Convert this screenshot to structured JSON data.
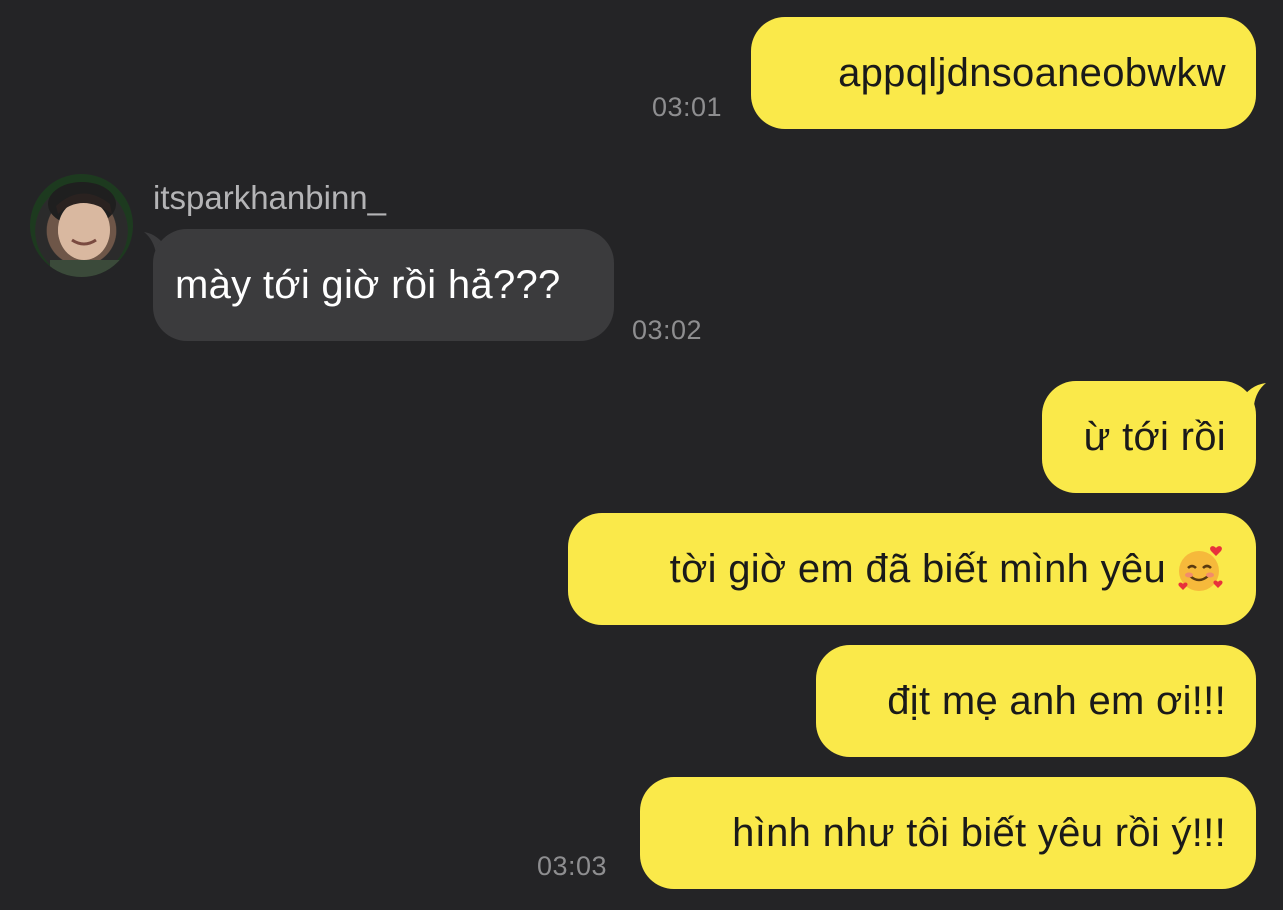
{
  "colors": {
    "background": "#242426",
    "outgoing_bubble": "#fae94a",
    "incoming_bubble": "#3b3b3d",
    "timestamp": "#8e8e90"
  },
  "messages": [
    {
      "direction": "outgoing",
      "text": "appqljdnsoaneobwkw",
      "time": "03:01"
    },
    {
      "direction": "incoming",
      "sender": "itsparkhanbinn_",
      "text": "mày tới giờ rồi hả???",
      "time": "03:02",
      "avatar": "avatar-photo"
    },
    {
      "direction": "outgoing",
      "text": "ừ tới rồi"
    },
    {
      "direction": "outgoing",
      "text": "tời giờ em đã biết mình yêu",
      "emoji": "smiling-face-with-hearts-emoji"
    },
    {
      "direction": "outgoing",
      "text": "địt mẹ anh em ơi!!!"
    },
    {
      "direction": "outgoing",
      "text": "hình như tôi biết yêu rồi ý!!!",
      "time": "03:03"
    }
  ]
}
